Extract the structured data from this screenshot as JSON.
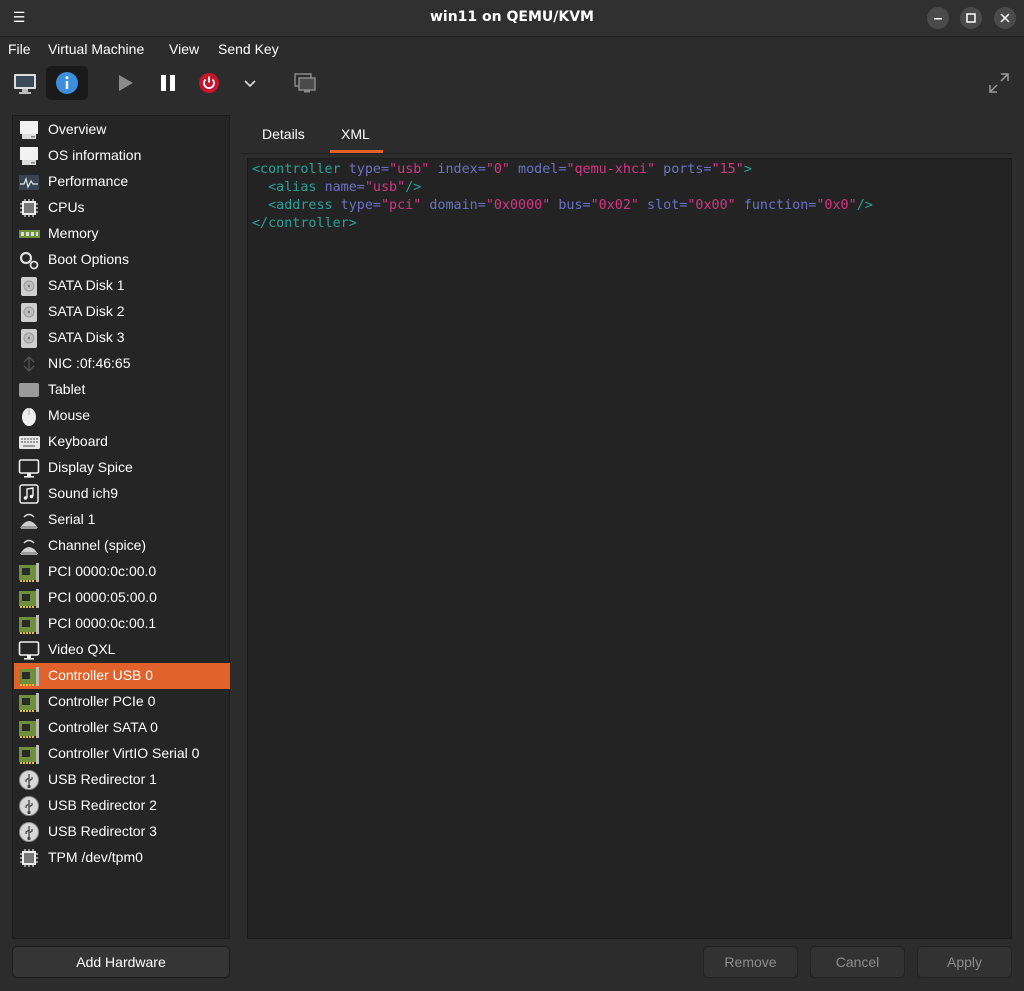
{
  "window": {
    "title": "win11 on QEMU/KVM"
  },
  "menubar": [
    "File",
    "Virtual Machine",
    "View",
    "Send Key"
  ],
  "toolbar": {
    "items": [
      "console-icon",
      "info-icon",
      "play-icon",
      "pause-icon",
      "power-icon",
      "chevron-down-icon",
      "screenshot-icon",
      "fullscreen-icon"
    ]
  },
  "sidebar": {
    "items": [
      {
        "label": "Overview",
        "icon": "overview-icon"
      },
      {
        "label": "OS information",
        "icon": "os-info-icon"
      },
      {
        "label": "Performance",
        "icon": "performance-icon"
      },
      {
        "label": "CPUs",
        "icon": "cpu-icon"
      },
      {
        "label": "Memory",
        "icon": "memory-icon"
      },
      {
        "label": "Boot Options",
        "icon": "boot-gear-icon"
      },
      {
        "label": "SATA Disk 1",
        "icon": "disk-icon"
      },
      {
        "label": "SATA Disk 2",
        "icon": "disk-icon"
      },
      {
        "label": "SATA Disk 3",
        "icon": "disk-icon"
      },
      {
        "label": "NIC :0f:46:65",
        "icon": "network-icon"
      },
      {
        "label": "Tablet",
        "icon": "tablet-icon"
      },
      {
        "label": "Mouse",
        "icon": "mouse-icon"
      },
      {
        "label": "Keyboard",
        "icon": "keyboard-icon"
      },
      {
        "label": "Display Spice",
        "icon": "display-icon"
      },
      {
        "label": "Sound ich9",
        "icon": "sound-icon"
      },
      {
        "label": "Serial 1",
        "icon": "serial-icon"
      },
      {
        "label": "Channel (spice)",
        "icon": "serial-icon"
      },
      {
        "label": "PCI 0000:0c:00.0",
        "icon": "pci-card-icon"
      },
      {
        "label": "PCI 0000:05:00.0",
        "icon": "pci-card-icon"
      },
      {
        "label": "PCI 0000:0c:00.1",
        "icon": "pci-card-icon"
      },
      {
        "label": "Video QXL",
        "icon": "display-icon"
      },
      {
        "label": "Controller USB 0",
        "icon": "pci-card-icon",
        "selected": true
      },
      {
        "label": "Controller PCIe 0",
        "icon": "pci-card-icon"
      },
      {
        "label": "Controller SATA 0",
        "icon": "pci-card-icon"
      },
      {
        "label": "Controller VirtIO Serial 0",
        "icon": "pci-card-icon"
      },
      {
        "label": "USB Redirector 1",
        "icon": "usb-icon"
      },
      {
        "label": "USB Redirector 2",
        "icon": "usb-icon"
      },
      {
        "label": "USB Redirector 3",
        "icon": "usb-icon"
      },
      {
        "label": "TPM /dev/tpm0",
        "icon": "tpm-chip-icon"
      }
    ],
    "add_button": "Add Hardware"
  },
  "tabs": [
    {
      "label": "Details",
      "active": false
    },
    {
      "label": "XML",
      "active": true
    }
  ],
  "xml": {
    "lines": [
      [
        [
          "t",
          "<controller "
        ],
        [
          "a",
          "type="
        ],
        [
          "v",
          "\"usb\""
        ],
        [
          "a",
          " index="
        ],
        [
          "v",
          "\"0\""
        ],
        [
          "a",
          " model="
        ],
        [
          "v",
          "\"qemu-xhci\""
        ],
        [
          "a",
          " ports="
        ],
        [
          "v",
          "\"15\""
        ],
        [
          "t",
          ">"
        ]
      ],
      [
        [
          "t",
          "  <alias "
        ],
        [
          "a",
          "name="
        ],
        [
          "v",
          "\"usb\""
        ],
        [
          "t",
          "/>"
        ]
      ],
      [
        [
          "t",
          "  <address "
        ],
        [
          "a",
          "type="
        ],
        [
          "v",
          "\"pci\""
        ],
        [
          "a",
          " domain="
        ],
        [
          "v",
          "\"0x0000\""
        ],
        [
          "a",
          " bus="
        ],
        [
          "v",
          "\"0x02\""
        ],
        [
          "a",
          " slot="
        ],
        [
          "v",
          "\"0x00\""
        ],
        [
          "a",
          " function="
        ],
        [
          "v",
          "\"0x0\""
        ],
        [
          "t",
          "/>"
        ]
      ],
      [
        [
          "t",
          "</controller>"
        ]
      ]
    ]
  },
  "buttons": {
    "remove": "Remove",
    "cancel": "Cancel",
    "apply": "Apply"
  },
  "colors": {
    "accent": "#e1622b",
    "xml_tag": "#2aa198",
    "xml_attr": "#6c71c4",
    "xml_value": "#d33682"
  }
}
